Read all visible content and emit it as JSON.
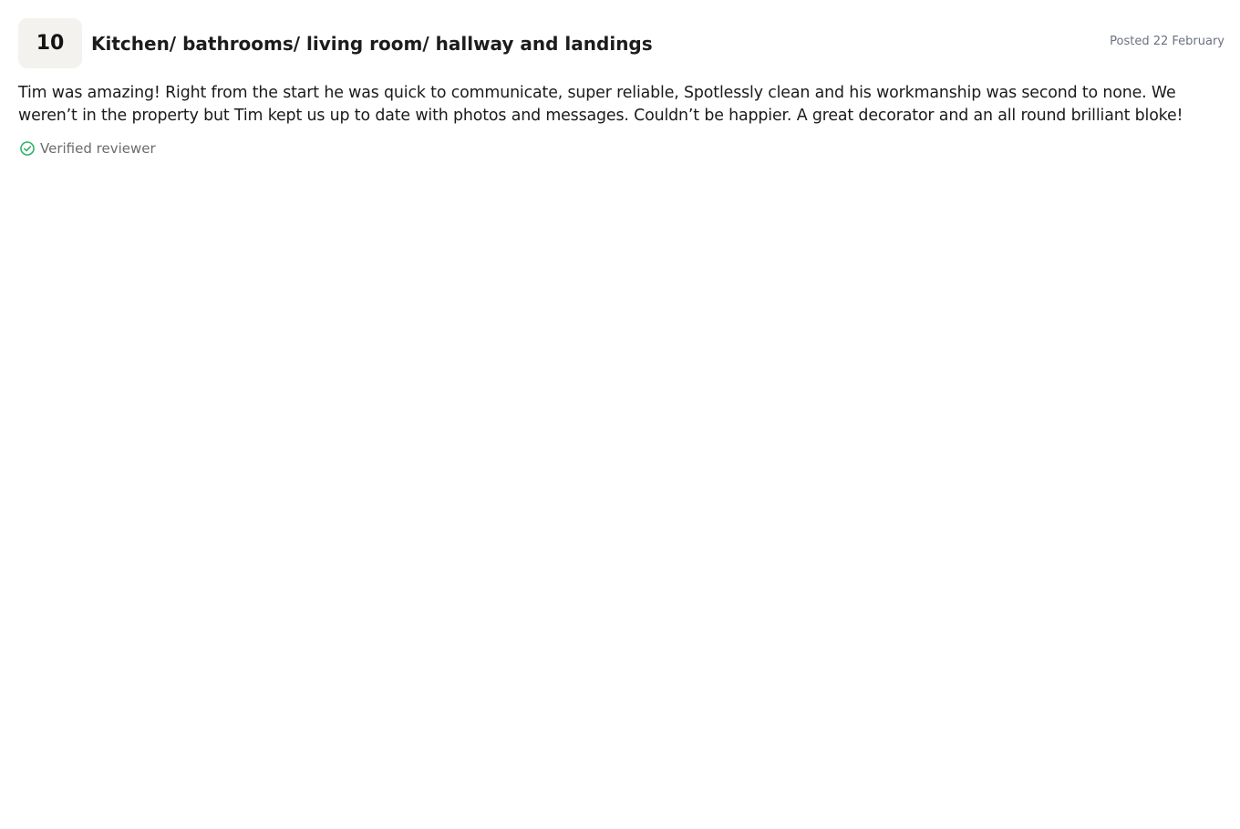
{
  "review": {
    "score": "10",
    "title": "Kitchen/ bathrooms/ living room/ hallway and landings",
    "posted": "Posted 22 February",
    "body": "Tim was amazing! Right from the start he was quick to communicate, super reliable, Spotlessly clean and his workmanship was second to none. We weren’t in the property but Tim kept us up to date with photos and messages. Couldn’t be happier. A great decorator and an all round brilliant bloke!",
    "verified_label": "Verified reviewer",
    "verified_icon": "check-circle-icon"
  },
  "colors": {
    "badge_background": "#f3f2ef",
    "verified_icon": "#2fb36b",
    "muted_text": "#6b7280"
  }
}
